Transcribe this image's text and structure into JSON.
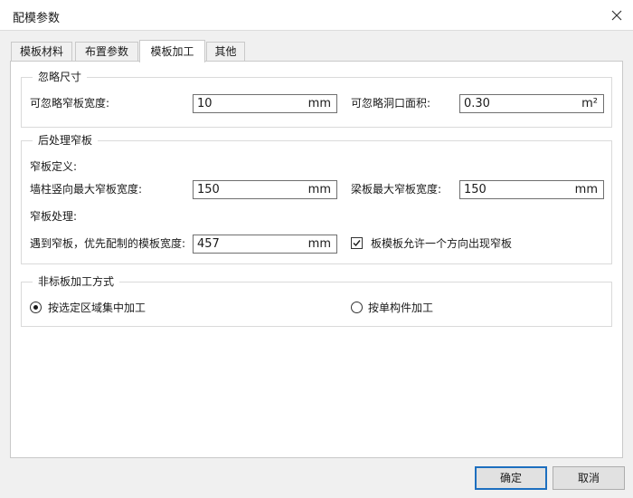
{
  "window": {
    "title": "配模参数"
  },
  "tabs": [
    {
      "label": "模板材料"
    },
    {
      "label": "布置参数"
    },
    {
      "label": "模板加工",
      "active": true
    },
    {
      "label": "其他"
    }
  ],
  "ignore_size": {
    "title": "忽略尺寸",
    "narrow_width_label": "可忽略窄板宽度:",
    "narrow_width_value": "10",
    "narrow_width_unit": "mm",
    "hole_area_label": "可忽略洞口面积:",
    "hole_area_value": "0.30",
    "hole_area_unit": "m²"
  },
  "post_narrow": {
    "title": "后处理窄板",
    "define_label": "窄板定义:",
    "wall_col_label": "墙柱竖向最大窄板宽度:",
    "wall_col_value": "150",
    "wall_col_unit": "mm",
    "beam_slab_label": "梁板最大窄板宽度:",
    "beam_slab_value": "150",
    "beam_slab_unit": "mm",
    "process_label": "窄板处理:",
    "priority_label": "遇到窄板，优先配制的模板宽度:",
    "priority_value": "457",
    "priority_unit": "mm",
    "allow_label": "板模板允许一个方向出现窄板",
    "allow_checked": true
  },
  "nonstandard": {
    "title": "非标板加工方式",
    "option_area_label": "按选定区域集中加工",
    "option_member_label": "按单构件加工",
    "selected": "area"
  },
  "buttons": {
    "ok": "确定",
    "cancel": "取消"
  }
}
